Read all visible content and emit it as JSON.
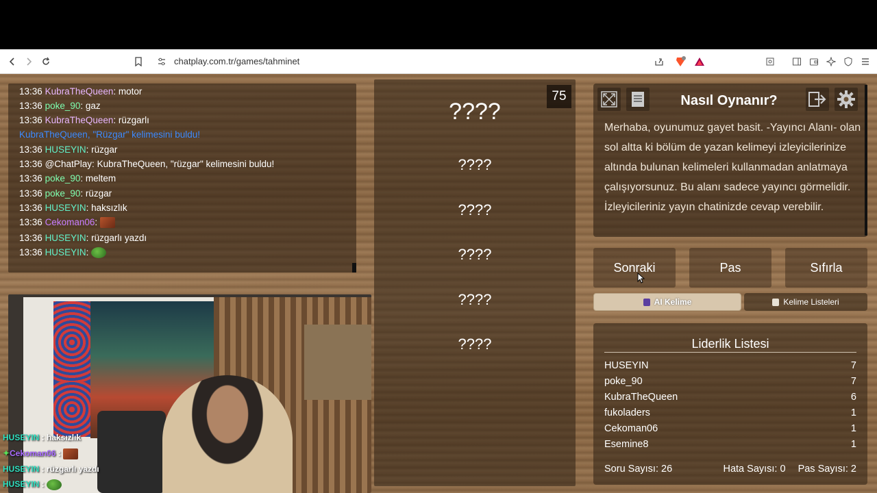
{
  "browser": {
    "url": "chatplay.com.tr/games/tahminet",
    "icons": [
      "back-icon",
      "forward-icon",
      "reload-icon",
      "bookmark-icon",
      "site-info-icon",
      "share-icon",
      "brave-shield-icon",
      "rewards-icon",
      "reader-icon",
      "sidebar-icon",
      "wallet-icon",
      "leo-icon",
      "vpn-icon",
      "menu-icon"
    ]
  },
  "chat": {
    "lines": [
      {
        "time": "13:36",
        "user": "KubraTheQueen",
        "message": "motor",
        "color": "kubra"
      },
      {
        "time": "13:36",
        "user": "poke_90",
        "message": "gaz",
        "color": "poke"
      },
      {
        "time": "13:36",
        "user": "KubraTheQueen",
        "message": "rüzgarlı",
        "color": "kubra"
      },
      {
        "system": "KubraTheQueen, \"Rüzgar\" kelimesini buldu!"
      },
      {
        "time": "13:36",
        "user": "HUSEYIN",
        "message": "rüzgar",
        "color": "huseyin"
      },
      {
        "time": "13:36",
        "user": "@ChatPlay",
        "message": "KubraTheQueen, \"rüzgar\" kelimesini buldu!",
        "color": "chatplay"
      },
      {
        "time": "13:36",
        "user": "poke_90",
        "message": "meltem",
        "color": "poke"
      },
      {
        "time": "13:36",
        "user": "poke_90",
        "message": "rüzgar",
        "color": "poke"
      },
      {
        "time": "13:36",
        "user": "HUSEYIN",
        "message": "haksızlık",
        "color": "huseyin"
      },
      {
        "time": "13:36",
        "user": "Cekoman06",
        "message": "",
        "emote": "face",
        "color": "cekoman"
      },
      {
        "time": "13:36",
        "user": "HUSEYIN",
        "message": "rüzgarlı yazdı",
        "color": "huseyin"
      },
      {
        "time": "13:36",
        "user": "HUSEYIN",
        "message": "",
        "emote": "frog",
        "color": "huseyin"
      }
    ]
  },
  "stream_overlay": [
    {
      "user": "HUSEYIN",
      "message": "haksızlık"
    },
    {
      "user": "Cekoman06",
      "message": ""
    },
    {
      "user": "HUSEYIN",
      "message": "rüzgarlı yazdı"
    },
    {
      "user": "HUSEYIN",
      "message": ""
    }
  ],
  "game": {
    "timer": "75",
    "words": [
      "????",
      "????",
      "????",
      "????",
      "????",
      "????"
    ]
  },
  "how_to": {
    "title": "Nasıl Oynanır?",
    "text": "Merhaba, oyunumuz gayet basit. -Yayıncı Alanı- olan sol altta ki bölüm de yazan kelimeyi izleyicilerinize altında bulunan kelimeleri kullanmadan anlatmaya çalışıyorsunuz. Bu alanı sadece yayıncı görmelidir. İzleyicileriniz yayın chatinizde cevap verebilir."
  },
  "controls": {
    "next": "Sonraki",
    "pass": "Pas",
    "reset": "Sıfırla",
    "ai_word": "AI Kelime",
    "word_lists": "Kelime Listeleri"
  },
  "leaderboard": {
    "title": "Liderlik Listesi",
    "rows": [
      {
        "name": "HUSEYIN",
        "score": "7"
      },
      {
        "name": "poke_90",
        "score": "7"
      },
      {
        "name": "KubraTheQueen",
        "score": "6"
      },
      {
        "name": "fukoladers",
        "score": "1"
      },
      {
        "name": "Cekoman06",
        "score": "1"
      },
      {
        "name": "Esemine8",
        "score": "1"
      }
    ],
    "question_count": "Soru Sayısı: 26",
    "error_count": "Hata Sayısı: 0",
    "pass_count": "Pas Sayısı: 2"
  },
  "colors": {
    "kubra": "#e9b7ff",
    "poke": "#7fffb0",
    "huseyin": "#62f0c8",
    "cekoman": "#c77dff",
    "system": "#3d8bff"
  }
}
